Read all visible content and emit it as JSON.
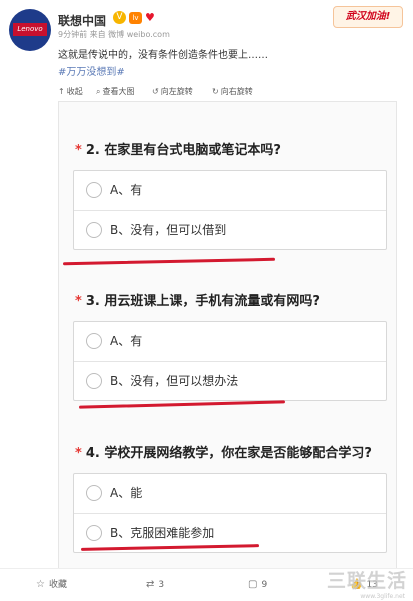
{
  "header": {
    "avatar_logo": "Lenovo",
    "user_name": "联想中国",
    "verified_badge": "V",
    "level_badge": "lv",
    "heart_badge": "♥",
    "meta": "9分钟前 来自 微博 weibo.com",
    "promo_banner": "武汉加油!",
    "post_text": "这就是传说中的，没有条件创造条件也要上……",
    "hashtag": "#万万没想到#"
  },
  "toolbar": {
    "collapse": "收起",
    "view_large": "查看大图",
    "rotate_left": "向左旋转",
    "rotate_right": "向右旋转"
  },
  "survey": {
    "questions": [
      {
        "number": "2.",
        "text": "在家里有台式电脑或笔记本吗?",
        "options": [
          "A、有",
          "B、没有，但可以借到"
        ]
      },
      {
        "number": "3.",
        "text": "用云班课上课，手机有流量或有网吗?",
        "options": [
          "A、有",
          "B、没有，但可以想办法"
        ]
      },
      {
        "number": "4.",
        "text": "学校开展网络教学，你在家是否能够配合学习?",
        "options": [
          "A、能",
          "B、克服困难能参加"
        ]
      }
    ],
    "required_mark": "*",
    "underline_color": "#d3192f"
  },
  "actions": {
    "favorite": "收藏",
    "repost_count": "3",
    "comment_count": "9",
    "like_count": "13"
  },
  "watermark": {
    "text": "三联生活",
    "url": "www.3glife.net"
  },
  "icons": {
    "collapse": "arrow-up-icon",
    "view_large": "magnify-icon",
    "rotate_left": "rotate-left-icon",
    "rotate_right": "rotate-right-icon",
    "favorite": "star-icon",
    "repost": "repost-icon",
    "comment": "comment-icon",
    "like": "thumbs-up-icon"
  }
}
